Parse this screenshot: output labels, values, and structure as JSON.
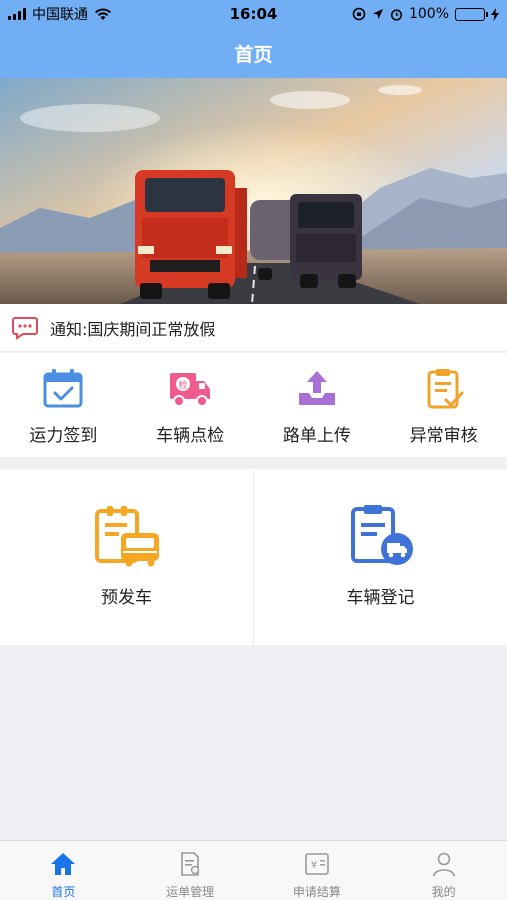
{
  "status_bar": {
    "carrier": "中国联通",
    "time": "16:04",
    "battery": "100%"
  },
  "navbar": {
    "title": "首页"
  },
  "banner": {
    "alt": ""
  },
  "notice": {
    "text": "通知:国庆期间正常放假",
    "icon": "message-icon"
  },
  "quick_actions": [
    {
      "label": "运力签到",
      "icon": "calendar-check-icon",
      "color": "#4a8fe0"
    },
    {
      "label": "车辆点检",
      "icon": "inspection-truck-icon",
      "color": "#ef5b8c"
    },
    {
      "label": "路单上传",
      "icon": "upload-icon",
      "color": "#a86fd6"
    },
    {
      "label": "异常审核",
      "icon": "audit-clipboard-icon",
      "color": "#f0a32a"
    }
  ],
  "cards": [
    {
      "label": "预发车",
      "icon": "pre-departure-bus-icon",
      "color": "#f5a623"
    },
    {
      "label": "车辆登记",
      "icon": "vehicle-register-icon",
      "color": "#3f73d9"
    }
  ],
  "tabs": [
    {
      "label": "首页",
      "icon": "home-icon",
      "active": true
    },
    {
      "label": "运单管理",
      "icon": "waybill-icon",
      "active": false
    },
    {
      "label": "申请结算",
      "icon": "settlement-icon",
      "active": false
    },
    {
      "label": "我的",
      "icon": "profile-icon",
      "active": false
    }
  ],
  "colors": {
    "header": "#72aef3",
    "active_tab": "#1a73e8",
    "background": "#efeff4"
  }
}
